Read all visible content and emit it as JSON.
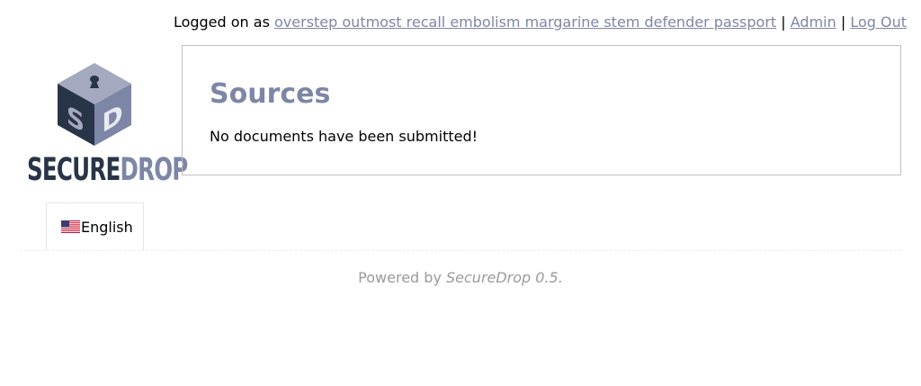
{
  "header": {
    "logged_on_prefix": "Logged on as",
    "username": "overstep outmost recall embolism margarine stem defender passport",
    "separator": "|",
    "admin_label": "Admin",
    "logout_label": "Log Out"
  },
  "logo": {
    "wordmark_part1": "SECURE",
    "wordmark_part2": "DROP",
    "cube_letters": [
      "S",
      "D"
    ]
  },
  "language": {
    "selected": "English",
    "flag_icon": "us-flag-icon"
  },
  "main": {
    "title": "Sources",
    "empty_message": "No documents have been submitted!"
  },
  "footer": {
    "powered_by": "Powered by",
    "product": "SecureDrop 0.5."
  },
  "colors": {
    "accent": "#7d86a6",
    "dark": "#283448",
    "footer_text": "#9a9a9a"
  }
}
